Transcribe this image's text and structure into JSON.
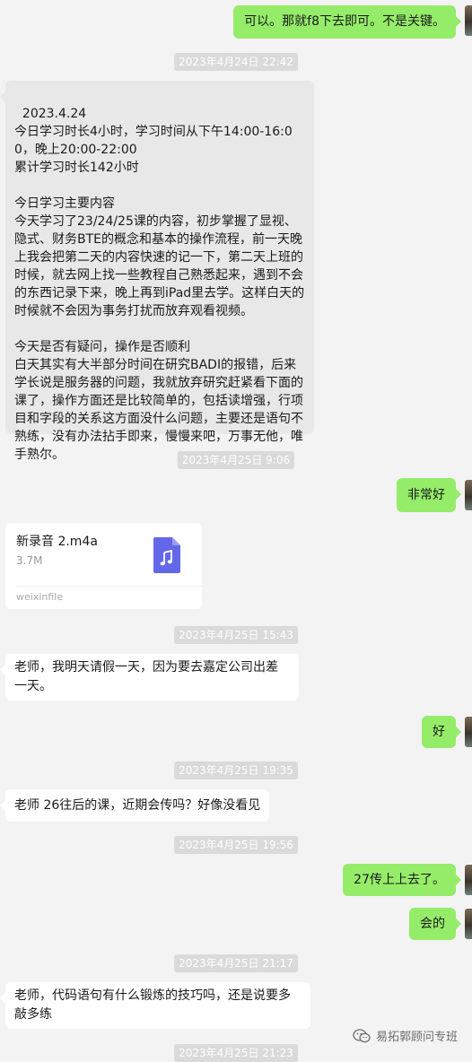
{
  "messages": {
    "m1": "可以。那就f8下去即可。不是关键。",
    "ts1": "2023年4月24日 22:42",
    "long": "2023.4.24\n今日学习时长4小时，学习时间从下午14:00-16:00，晚上20:00-22:00\n累计学习时长142小时\n\n今日学习主要内容\n今天学习了23/24/25课的内容，初步掌握了显视、隐式、财务BTE的概念和基本的操作流程，前一天晚上我会把第二天的内容快速的记一下，第二天上班的时候，就去网上找一些教程自己熟悉起来，遇到不会的东西记录下来，晚上再到iPad里去学。这样白天的时候就不会因为事务打扰而放弃观看视频。\n\n今天是否有疑问，操作是否顺利\n白天其实有大半部分时间在研究BADI的报错，后来学长说是服务器的问题，我就放弃研究赶紧看下面的课了，操作方面还是比较简单的，包括读增强，行项目和字段的关系这方面没什么问题，主要还是语句不熟练，没有办法拈手即来，慢慢来吧，万事无他，唯手熟尔。",
    "ts2": "2023年4月25日 9:06",
    "m2": "非常好",
    "file": {
      "name": "新录音 2.m4a",
      "size": "3.7M",
      "source": "weixinfile"
    },
    "ts3": "2023年4月25日 15:43",
    "m3": "老师，我明天请假一天，因为要去嘉定公司出差一天。",
    "m4": "好",
    "ts4": "2023年4月25日 19:35",
    "m5": "老师 26往后的课，近期会传吗？好像没看见",
    "ts5": "2023年4月25日 19:56",
    "m6": "27传上上去了。",
    "m7": "会的",
    "ts6": "2023年4月25日 21:17",
    "m8": "老师，代码语句有什么锻炼的技巧吗，还是说要多敲多练",
    "ts7": "2023年4月25日 21:23"
  },
  "watermark": {
    "text": "易拓郭顾问专班",
    "icon": "wechat-official-account-icon"
  },
  "colors": {
    "right_bubble": "#95ec69",
    "left_bubble": "#ffffff",
    "long_bubble": "#e8e8e8",
    "background": "#f3f3f3"
  }
}
